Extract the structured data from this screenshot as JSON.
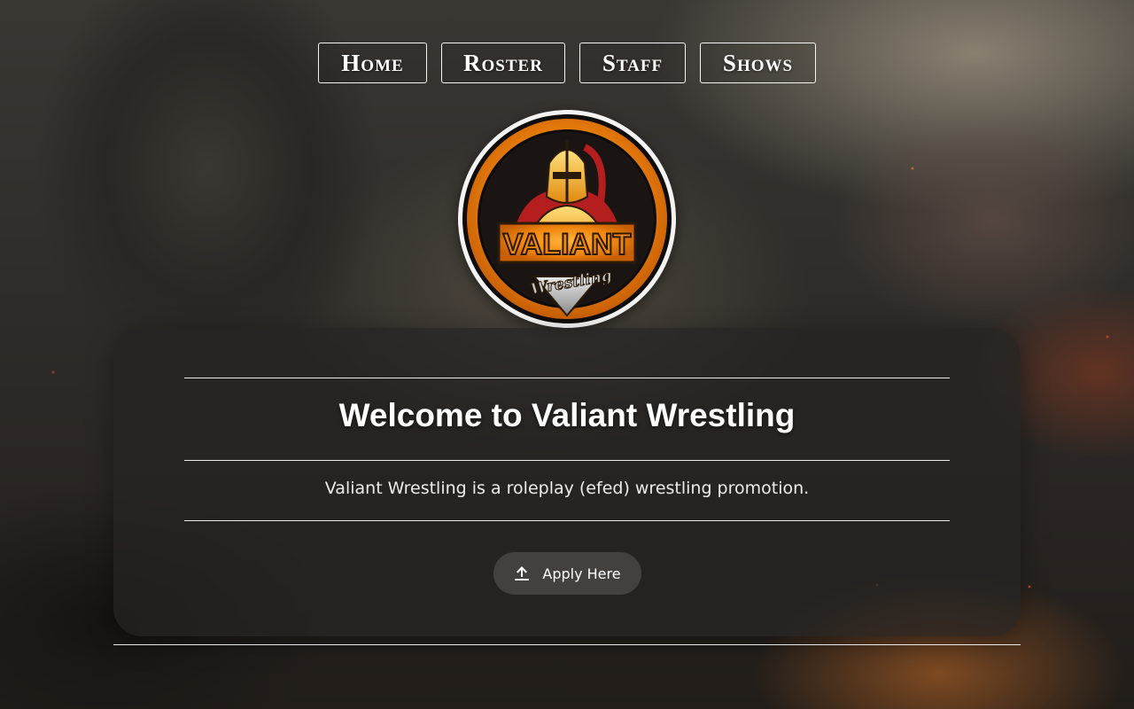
{
  "nav": {
    "items": [
      {
        "label": "Home"
      },
      {
        "label": "Roster"
      },
      {
        "label": "Staff"
      },
      {
        "label": "Shows"
      }
    ]
  },
  "logo": {
    "text": "VALIANT",
    "subtext": "Wrestling",
    "colors": {
      "ring": "#f4f4f4",
      "orange": "#f2870f",
      "gold": "#f0b21e",
      "dark": "#0e0d0c",
      "red": "#b51e1e",
      "silver": "#b8b8b8"
    }
  },
  "welcome": {
    "title": "Welcome to Valiant Wrestling",
    "description": "Valiant Wrestling is a roleplay (efed) wrestling promotion."
  },
  "apply": {
    "label": "Apply Here",
    "icon": "upload-icon"
  },
  "theme": {
    "card_bg": "#262422",
    "text": "#ffffff",
    "rule": "#ffffff"
  }
}
